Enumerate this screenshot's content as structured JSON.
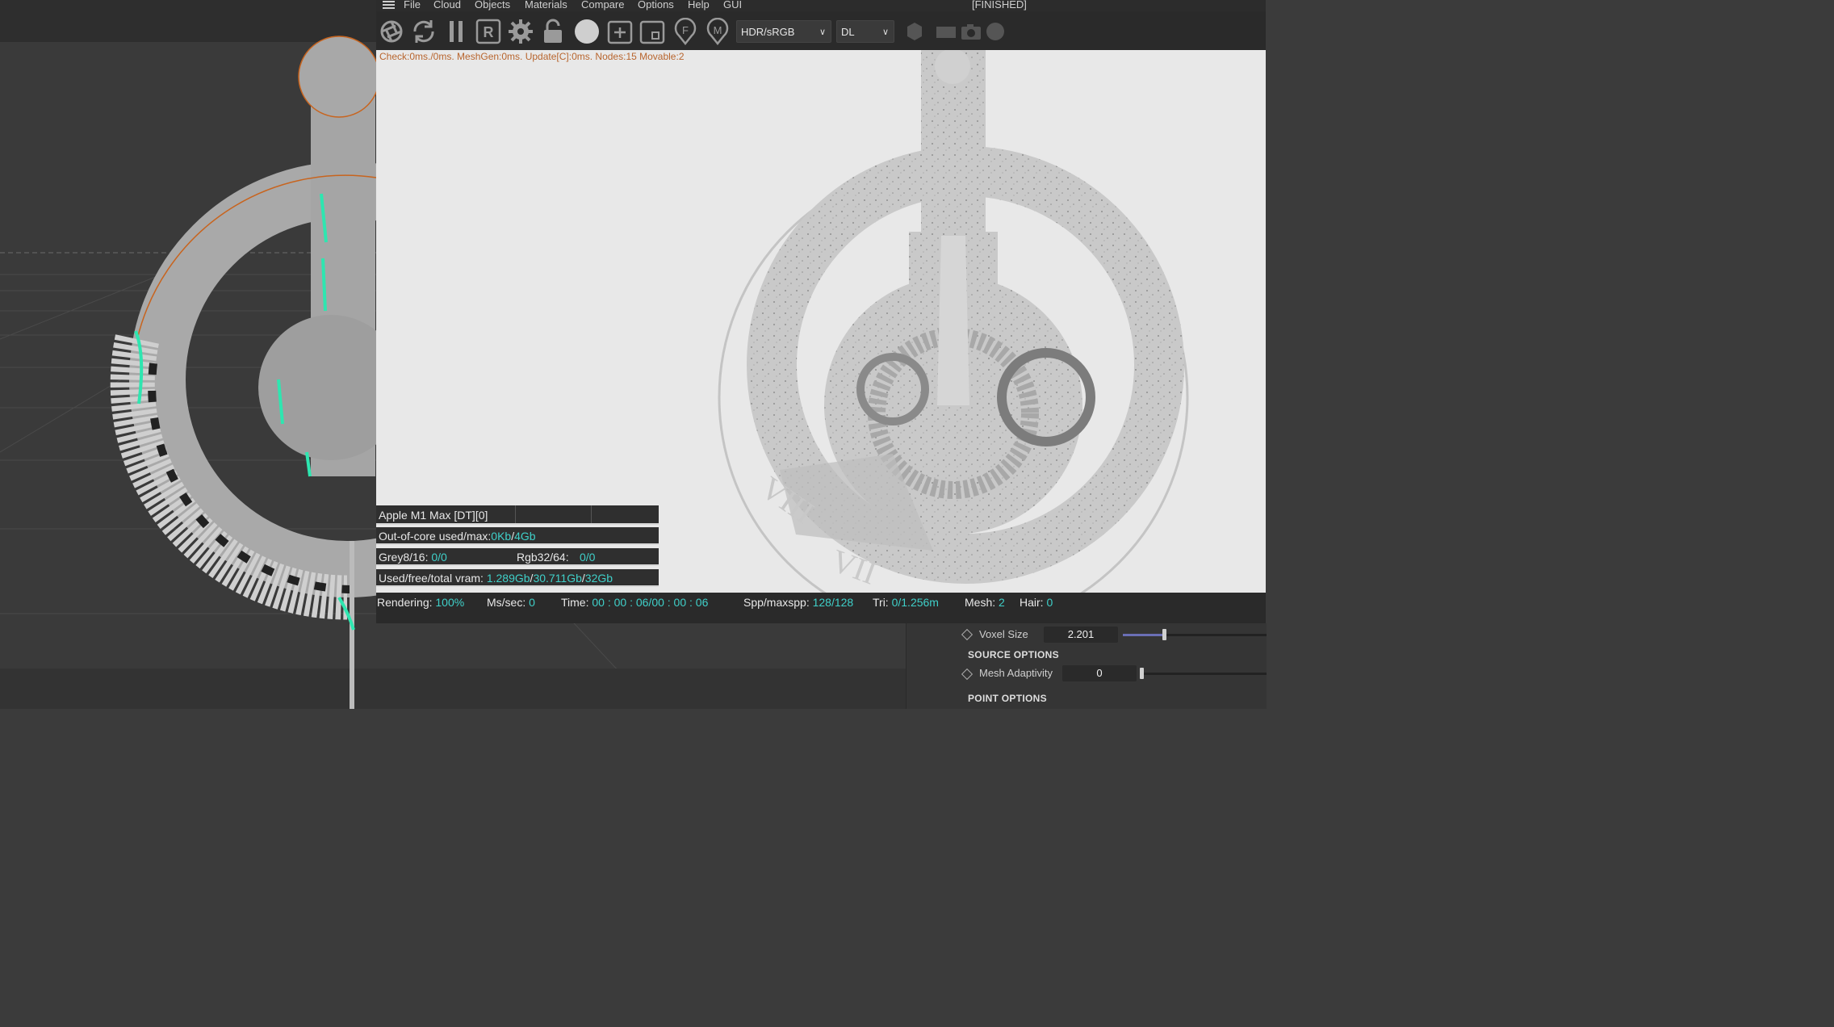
{
  "menu": {
    "items": [
      "File",
      "Cloud",
      "Objects",
      "Materials",
      "Compare",
      "Options",
      "Help",
      "GUI"
    ],
    "status": "[FINISHED]"
  },
  "toolbar": {
    "icons": [
      "aperture-icon",
      "refresh-icon",
      "pause-icon",
      "region-r-icon",
      "gear-icon",
      "lock-icon",
      "sphere-icon",
      "add-frame-icon",
      "frame-icon",
      "focus-f-icon",
      "material-m-icon"
    ],
    "colorspace_select": "HDR/sRGB",
    "kernel_select": "DL",
    "right_icons": [
      "hexagon-icon",
      "film-icon",
      "camera-icon",
      "circle-icon"
    ]
  },
  "render": {
    "check_line": "Check:0ms./0ms. MeshGen:0ms. Update[C]:0ms. Nodes:15 Movable:2"
  },
  "stats": {
    "device": "Apple M1 Max [DT][0]",
    "out_of_core_label": "Out-of-core used/max:",
    "out_of_core_used": "0Kb",
    "out_of_core_max": "4Gb",
    "grey_label": "Grey8/16:",
    "grey_value": "0/0",
    "rgb_label": "Rgb32/64:",
    "rgb_value": "0/0",
    "vram_label": "Used/free/total vram:",
    "vram_used": "1.289Gb",
    "vram_free": "30.711Gb",
    "vram_total": "32Gb",
    "sep": "/"
  },
  "bottom_bar": {
    "rendering_label": "Rendering:",
    "rendering_value": "100%",
    "ms_label": "Ms/sec:",
    "ms_value": "0",
    "time_label": "Time:",
    "time_value": "00 : 00 : 06/00 : 00 : 06",
    "spp_label": "Spp/maxspp:",
    "spp_value": "128/128",
    "tri_label": "Tri:",
    "tri_value": "0/1.256m",
    "mesh_label": "Mesh:",
    "mesh_value": "2",
    "hair_label": "Hair:",
    "hair_value": "0"
  },
  "attributes": {
    "voxel_size_label": "Voxel Size",
    "voxel_size_value": "2.201",
    "voxel_size_fraction": 0.12,
    "source_options_title": "SOURCE OPTIONS",
    "mesh_adaptivity_label": "Mesh Adaptivity",
    "mesh_adaptivity_value": "0",
    "mesh_adaptivity_fraction": 0.0,
    "point_options_title": "POINT OPTIONS"
  },
  "colors": {
    "highlight": "#3fd0c9",
    "check_text": "#b8652e",
    "selection_outline": "#c8641e",
    "vertex_highlight": "#2ee6b0"
  }
}
